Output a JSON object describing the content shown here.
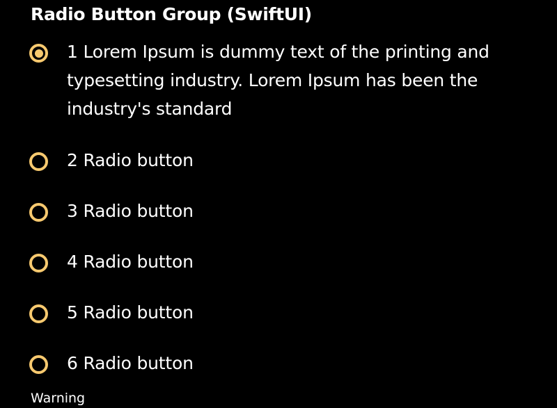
{
  "title": "Radio Button Group (SwiftUI)",
  "accent_color": "#f7c96f",
  "options": [
    {
      "label": "1 Lorem Ipsum is dummy text of the printing and typesetting industry. Lorem Ipsum has been the industry's standard",
      "selected": true
    },
    {
      "label": "2 Radio button",
      "selected": false
    },
    {
      "label": "3 Radio button",
      "selected": false
    },
    {
      "label": "4 Radio button",
      "selected": false
    },
    {
      "label": "5 Radio button",
      "selected": false
    },
    {
      "label": "6 Radio button",
      "selected": false
    }
  ],
  "footer": {
    "warning": "Warning"
  }
}
